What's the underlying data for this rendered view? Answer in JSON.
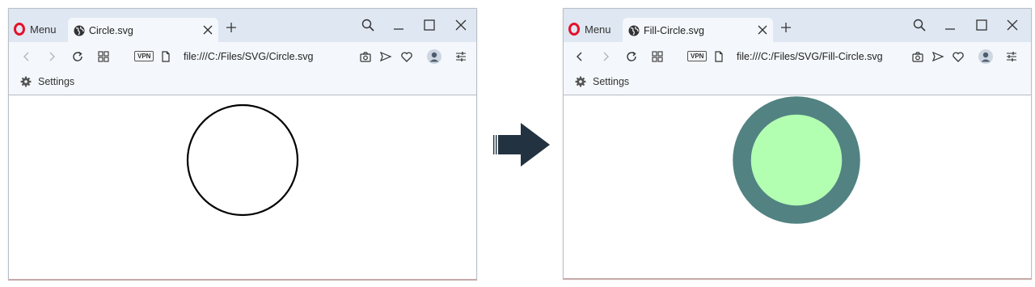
{
  "colors": {
    "tabbar_bg": "#dfe7f2",
    "toolbar_bg": "#f4f7fb",
    "opera_red": "#e4112b",
    "arrow_fill": "#223240",
    "circle_stroke_left": "#000000",
    "circle_stroke_right": "#528282",
    "circle_fill_right": "#b2ffb2"
  },
  "arrow": {
    "icon": "right-arrow-icon"
  },
  "browsers": [
    {
      "menu_label": "Menu",
      "tab_title": "Circle.svg",
      "vpn_label": "VPN",
      "url": "file:///C:/Files/SVG/Circle.svg",
      "bookmark_label": "Settings",
      "svg_circle": {
        "fill": "none",
        "stroke": "#000000"
      }
    },
    {
      "menu_label": "Menu",
      "tab_title": "Fill-Circle.svg",
      "vpn_label": "VPN",
      "url": "file:///C:/Files/SVG/Fill-Circle.svg",
      "bookmark_label": "Settings",
      "svg_circle": {
        "fill": "#b2ffb2",
        "stroke": "#528282"
      }
    }
  ]
}
